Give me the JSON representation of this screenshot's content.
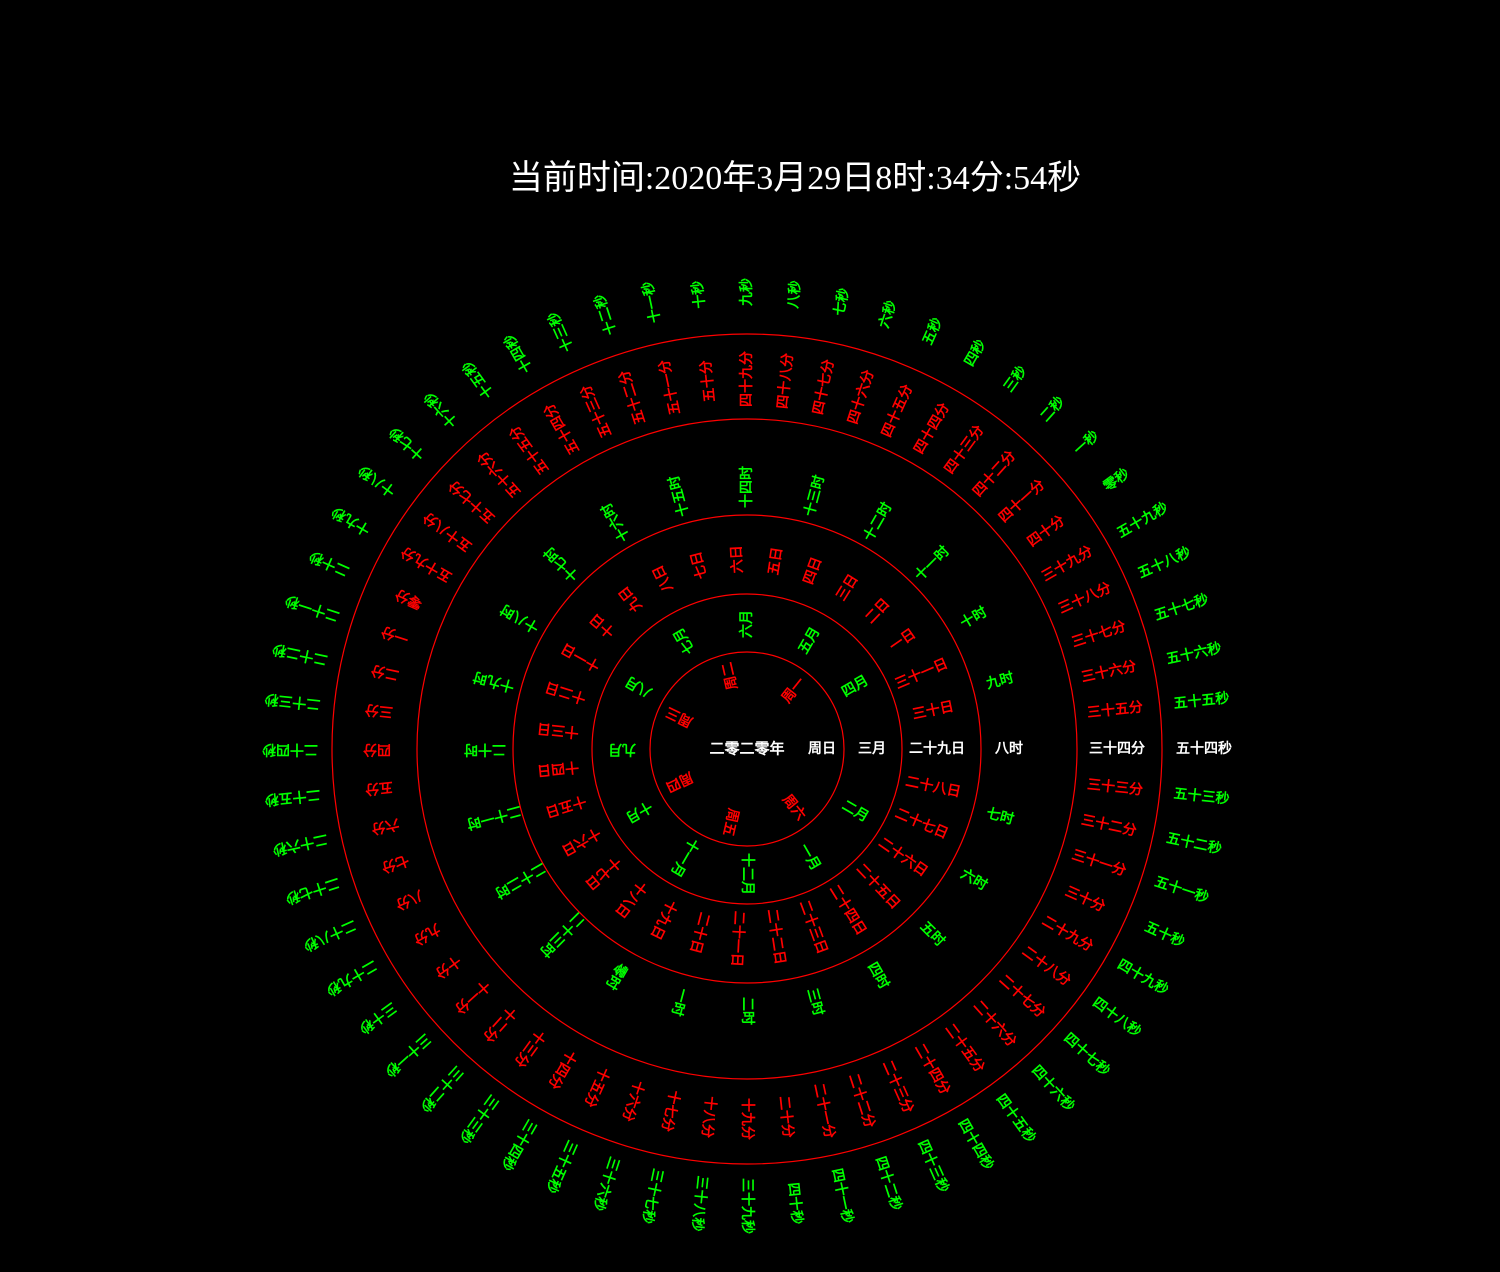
{
  "header": {
    "title": "当前时间:2020年3月29日8时:34分:54秒"
  },
  "colors": {
    "background": "#000000",
    "active": "#ffffff",
    "ring_line": "#ff0000",
    "green": "#00ff00",
    "red": "#ff0000"
  },
  "center": {
    "year": "二零二零年"
  },
  "rings": {
    "weekday": {
      "color": "#ff0000",
      "items": [
        "周一",
        "周二",
        "周三",
        "周四",
        "周五",
        "周六",
        "周日"
      ],
      "active": "周日"
    },
    "month": {
      "color": "#00ff00",
      "items": [
        "一月",
        "二月",
        "三月",
        "四月",
        "五月",
        "六月",
        "七月",
        "八月",
        "九月",
        "十月",
        "十一月",
        "十二月"
      ],
      "active": "三月"
    },
    "day": {
      "color": "#ff0000",
      "items": [
        "一日",
        "二日",
        "三日",
        "四日",
        "五日",
        "六日",
        "七日",
        "八日",
        "九日",
        "十日",
        "十一日",
        "十二日",
        "十三日",
        "十四日",
        "十五日",
        "十六日",
        "十七日",
        "十八日",
        "十九日",
        "二十日",
        "二十一日",
        "二十二日",
        "二十三日",
        "二十四日",
        "二十五日",
        "二十六日",
        "二十七日",
        "二十八日",
        "二十九日",
        "三十日",
        "三十一日"
      ],
      "active": "二十九日"
    },
    "hour": {
      "color": "#00ff00",
      "items": [
        "零时",
        "一时",
        "二时",
        "三时",
        "四时",
        "五时",
        "六时",
        "七时",
        "八时",
        "九时",
        "十时",
        "十一时",
        "十二时",
        "十三时",
        "十四时",
        "十五时",
        "十六时",
        "十七时",
        "十八时",
        "十九时",
        "二十时",
        "二十一时",
        "二十二时",
        "二十三时"
      ],
      "active": "八时"
    },
    "minute": {
      "color": "#ff0000",
      "items": [
        "零分",
        "一分",
        "二分",
        "三分",
        "四分",
        "五分",
        "六分",
        "七分",
        "八分",
        "九分",
        "十分",
        "十一分",
        "十二分",
        "十三分",
        "十四分",
        "十五分",
        "十六分",
        "十七分",
        "十八分",
        "十九分",
        "二十分",
        "二十一分",
        "二十二分",
        "二十三分",
        "二十四分",
        "二十五分",
        "二十六分",
        "二十七分",
        "二十八分",
        "二十九分",
        "三十分",
        "三十一分",
        "三十二分",
        "三十三分",
        "三十四分",
        "三十五分",
        "三十六分",
        "三十七分",
        "三十八分",
        "三十九分",
        "四十分",
        "四十一分",
        "四十二分",
        "四十三分",
        "四十四分",
        "四十五分",
        "四十六分",
        "四十七分",
        "四十八分",
        "四十九分",
        "五十分",
        "五十一分",
        "五十二分",
        "五十三分",
        "五十四分",
        "五十五分",
        "五十六分",
        "五十七分",
        "五十八分",
        "五十九分"
      ],
      "active": "三十四分"
    },
    "second": {
      "color": "#00ff00",
      "items": [
        "零秒",
        "一秒",
        "二秒",
        "三秒",
        "四秒",
        "五秒",
        "六秒",
        "七秒",
        "八秒",
        "九秒",
        "十秒",
        "十一秒",
        "十二秒",
        "十三秒",
        "十四秒",
        "十五秒",
        "十六秒",
        "十七秒",
        "十八秒",
        "十九秒",
        "二十秒",
        "二十一秒",
        "二十二秒",
        "二十三秒",
        "二十四秒",
        "二十五秒",
        "二十六秒",
        "二十七秒",
        "二十八秒",
        "二十九秒",
        "三十秒",
        "三十一秒",
        "三十二秒",
        "三十三秒",
        "三十四秒",
        "三十五秒",
        "三十六秒",
        "三十七秒",
        "三十八秒",
        "三十九秒",
        "四十秒",
        "四十一秒",
        "四十二秒",
        "四十三秒",
        "四十四秒",
        "四十五秒",
        "四十六秒",
        "四十七秒",
        "四十八秒",
        "四十九秒",
        "五十秒",
        "五十一秒",
        "五十二秒",
        "五十三秒",
        "五十四秒",
        "五十五秒",
        "五十六秒",
        "五十七秒",
        "五十八秒",
        "五十九秒"
      ],
      "active": "五十四秒"
    }
  }
}
